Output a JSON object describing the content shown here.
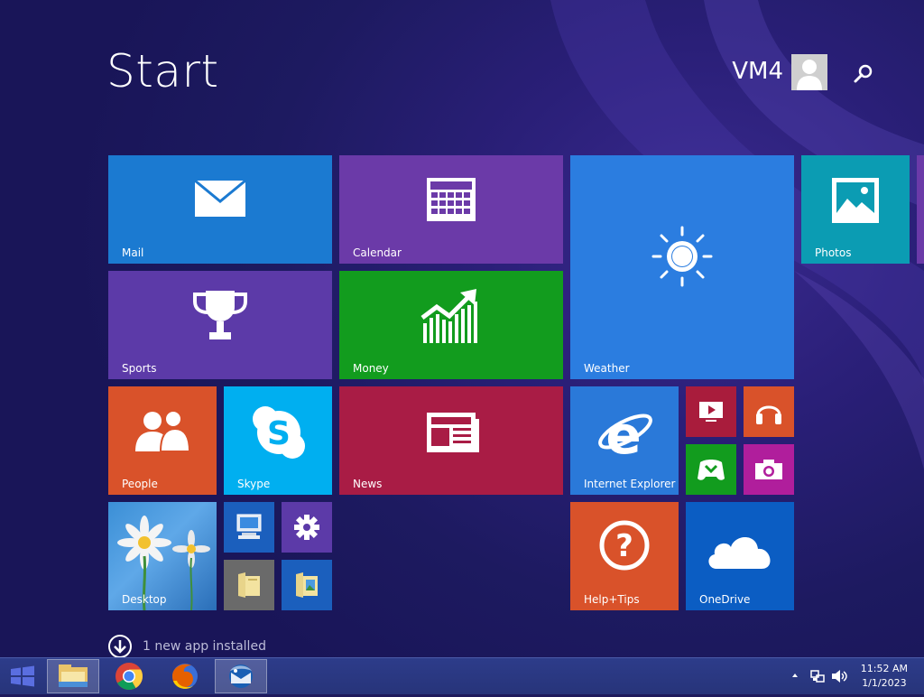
{
  "start": {
    "title": "Start"
  },
  "user": {
    "name": "VM4"
  },
  "tiles": {
    "mail": {
      "label": "Mail",
      "color": "#1b7ad1"
    },
    "calendar": {
      "label": "Calendar",
      "color": "#6b3aa8"
    },
    "weather": {
      "label": "Weather",
      "color": "#2b7de0"
    },
    "photos": {
      "label": "Photos",
      "color": "#0b9cb3"
    },
    "sports": {
      "label": "Sports",
      "color": "#5c3aa8"
    },
    "money": {
      "label": "Money",
      "color": "#129c1e"
    },
    "people": {
      "label": "People",
      "color": "#d9522a"
    },
    "skype": {
      "label": "Skype",
      "color": "#00aff0"
    },
    "news": {
      "label": "News",
      "color": "#a91c45"
    },
    "internet_explorer": {
      "label": "Internet Explorer",
      "color": "#2a79d9"
    },
    "desktop": {
      "label": "Desktop"
    },
    "help_tips": {
      "label": "Help+Tips",
      "color": "#d9522a"
    },
    "onedrive": {
      "label": "OneDrive",
      "color": "#0b5dc3"
    }
  },
  "notice": {
    "text": "1 new app installed"
  },
  "taskbar": {
    "clock": {
      "time": "11:52 AM",
      "date": "1/1/2023"
    },
    "apps": [
      "file-explorer",
      "chrome",
      "firefox",
      "thunderbird"
    ]
  }
}
